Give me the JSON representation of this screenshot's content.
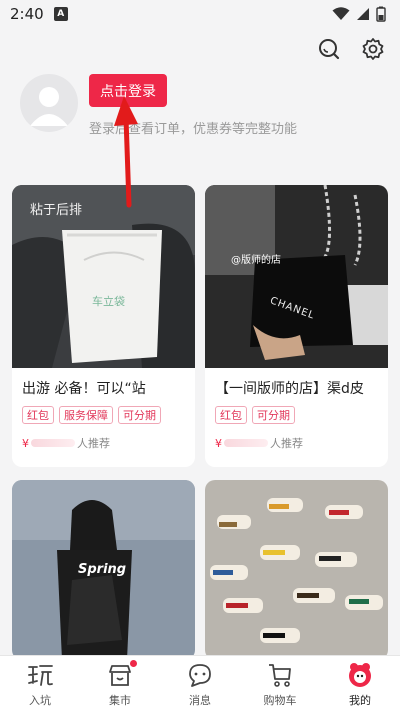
{
  "status_bar": {
    "time": "2:40",
    "notification_icon": "A"
  },
  "top_icons": [
    "search-icon",
    "settings-gear-icon"
  ],
  "profile": {
    "login_button": "点击登录",
    "hint": "登录后查看订单，优惠券等完整功能"
  },
  "products": [
    {
      "overlay": "粘于后排",
      "title": "出游  必备！可以“站",
      "tags": [
        "红包",
        "服务保障",
        "可分期"
      ],
      "price_symbol": "¥",
      "recommend": "人推荐"
    },
    {
      "overlay": "",
      "title": "【一间版师的店】渠d皮",
      "tags": [
        "红包",
        "可分期"
      ],
      "price_symbol": "¥",
      "recommend": "人推荐"
    },
    {
      "overlay": "Spring",
      "title": "",
      "tags": [],
      "price_symbol": "",
      "recommend": ""
    },
    {
      "overlay": "",
      "title": "",
      "tags": [],
      "price_symbol": "",
      "recommend": ""
    }
  ],
  "image_text": {
    "bag_logo": "车立袋",
    "store_watermark": "@版师的店",
    "chanel": "CHANEL"
  },
  "tabs": [
    {
      "label": "入坑",
      "icon": "play-char-icon"
    },
    {
      "label": "集市",
      "icon": "market-store-icon"
    },
    {
      "label": "消息",
      "icon": "message-bubble-icon"
    },
    {
      "label": "购物车",
      "icon": "shopping-cart-icon"
    },
    {
      "label": "我的",
      "icon": "profile-mascot-icon"
    }
  ],
  "colors": {
    "accent": "#ee2748",
    "background": "#f4f4f5"
  }
}
